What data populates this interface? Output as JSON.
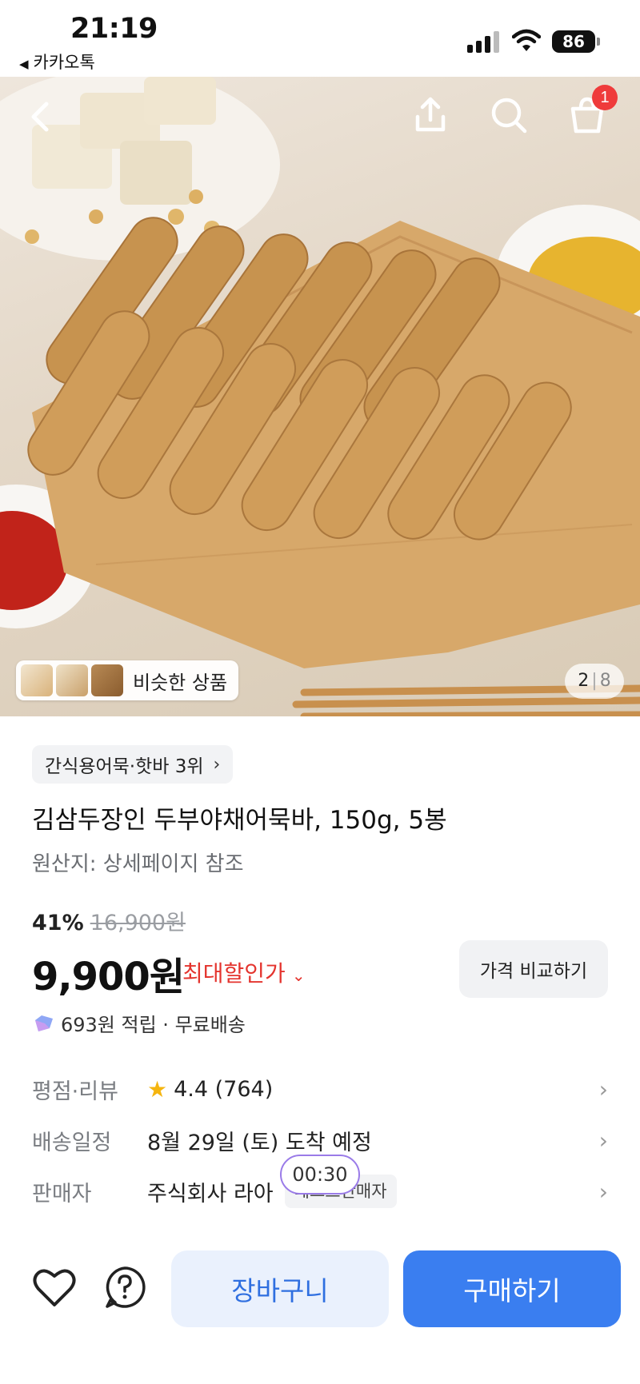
{
  "status_bar": {
    "time": "21:19",
    "back_app": "카카오톡",
    "battery": "86",
    "icons": [
      "signal-icon",
      "wifi-icon",
      "battery-icon"
    ]
  },
  "header": {
    "icons": [
      "back-icon",
      "share-icon",
      "search-icon",
      "cart-icon"
    ],
    "cart_badge": "1"
  },
  "gallery": {
    "similar_label": "비슷한 상품",
    "current": "2",
    "total": "8"
  },
  "product": {
    "rank_chip": "간식용어묵·핫바 3위",
    "title": "김삼두장인 두부야채어묵바, 150g, 5봉",
    "origin": "원산지: 상세페이지 참조",
    "discount": "41%",
    "original_price": "16,900원",
    "price": "9,900원",
    "max_sale_label": "최대할인가",
    "compare_label": "가격 비교하기",
    "points": "693원 적립 · 무료배송"
  },
  "info": {
    "rating_label": "평점·리뷰",
    "rating": "4.4 (764)",
    "delivery_label": "배송일정",
    "delivery": "8월 29일 (토) 도착 예정",
    "seller_label": "판매자",
    "seller": "주식회사 라아",
    "seller_tag": "베스트판매자",
    "timer": "00:30"
  },
  "bottom": {
    "cart_label": "장바구니",
    "buy_label": "구매하기"
  },
  "colors": {
    "accent": "#3a7ef0",
    "sale_red": "#e4342e",
    "badge_red": "#ef3b3b",
    "star": "#f5b50f"
  }
}
